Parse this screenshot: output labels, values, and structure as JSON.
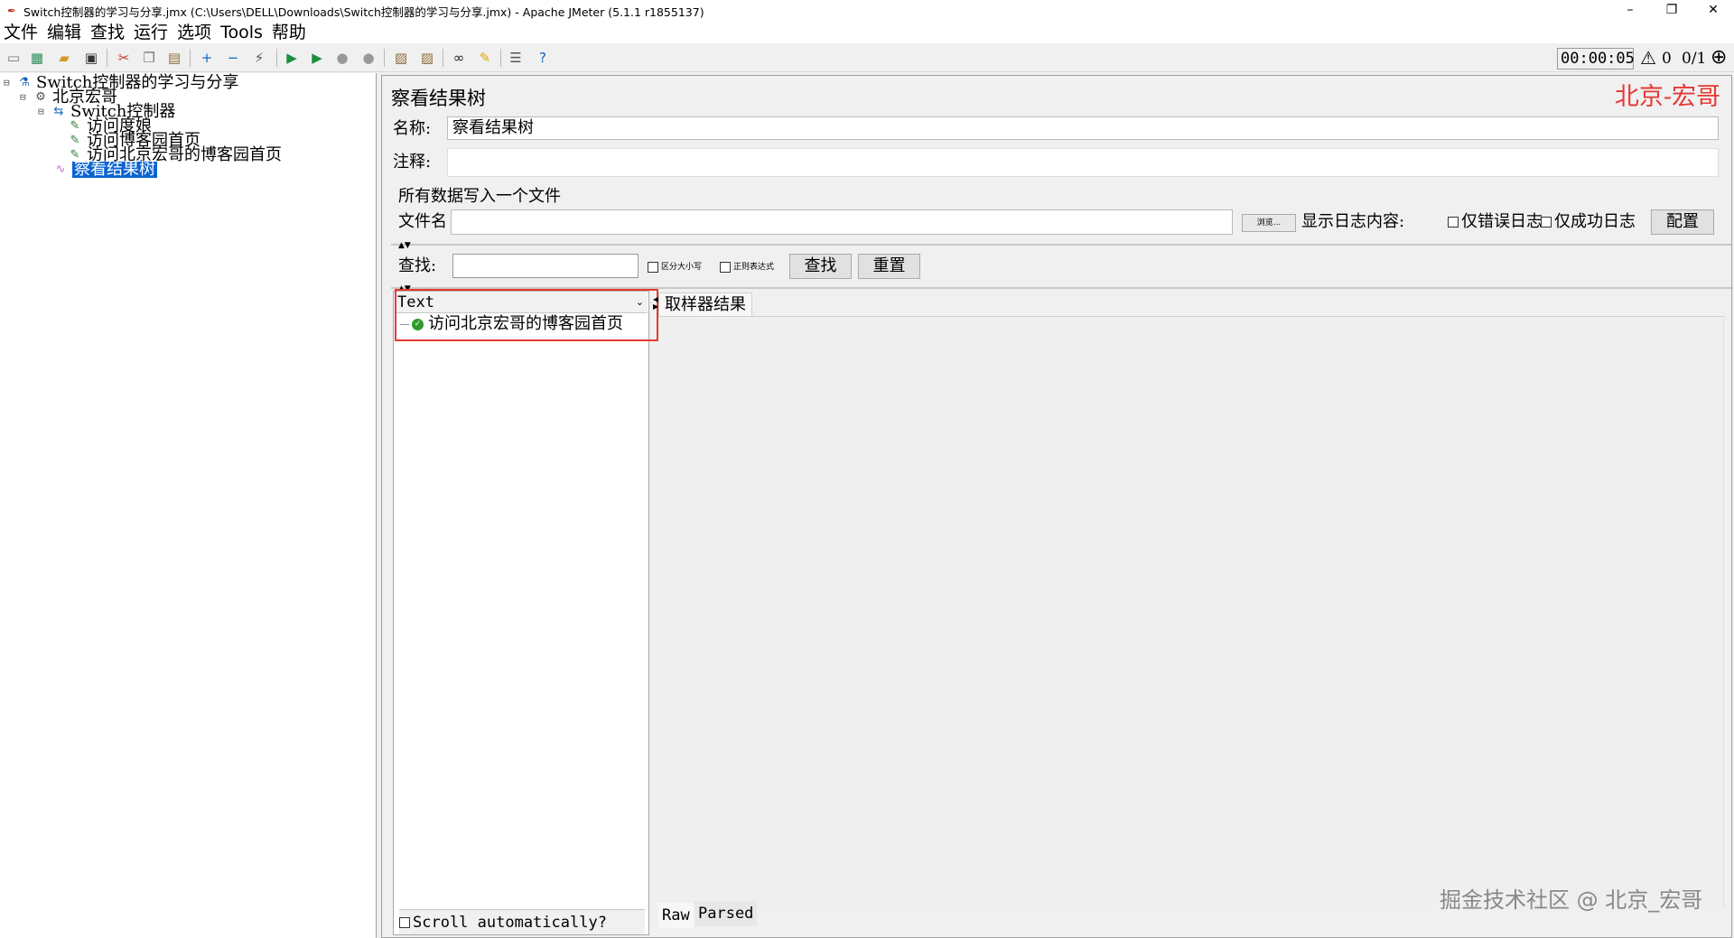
{
  "window": {
    "title": "Switch控制器的学习与分享.jmx (C:\\Users\\DELL\\Downloads\\Switch控制器的学习与分享.jmx) - Apache JMeter (5.1.1 r1855137)",
    "minimize": "–",
    "restore": "❐",
    "close": "✕"
  },
  "menu": {
    "items": [
      "文件",
      "编辑",
      "查找",
      "运行",
      "选项",
      "Tools",
      "帮助"
    ]
  },
  "toolbar": {
    "timer": "00:00:05",
    "warnings": "0",
    "threads": "0/1"
  },
  "tree": {
    "nodes": [
      {
        "label": "Switch控制器的学习与分享",
        "icon": "test-plan-icon"
      },
      {
        "label": "北京宏哥",
        "icon": "thread-group-icon"
      },
      {
        "label": "Switch控制器",
        "icon": "switch-controller-icon"
      },
      {
        "label": "访问度娘",
        "icon": "sampler-icon"
      },
      {
        "label": "访问博客园首页",
        "icon": "sampler-icon"
      },
      {
        "label": "访问北京宏哥的博客园首页",
        "icon": "sampler-icon"
      },
      {
        "label": "察看结果树",
        "icon": "listener-icon"
      }
    ]
  },
  "panel": {
    "title": "察看结果树",
    "watermark": "北京-宏哥",
    "name_label": "名称:",
    "name_value": "察看结果树",
    "comment_label": "注释:",
    "file_legend": "所有数据写入一个文件",
    "file_label": "文件名",
    "browse": "浏览...",
    "log_label": "显示日志内容:",
    "errors_only": "仅错误日志",
    "success_only": "仅成功日志",
    "configure": "配置"
  },
  "search": {
    "label": "查找:",
    "case_sensitive": "区分大小写",
    "regex": "正则表达式",
    "find": "查找",
    "reset": "重置"
  },
  "results": {
    "renderer": "Text",
    "sample": "访问北京宏哥的博客园首页",
    "sample_status": "success",
    "scroll_auto": "Scroll automatically?",
    "tab_sampler": "取样器结果",
    "tab_raw": "Raw",
    "tab_parsed": "Parsed",
    "highlight_color": "#e53935"
  },
  "watermark_bottom": "掘金技术社区 @ 北京_宏哥"
}
